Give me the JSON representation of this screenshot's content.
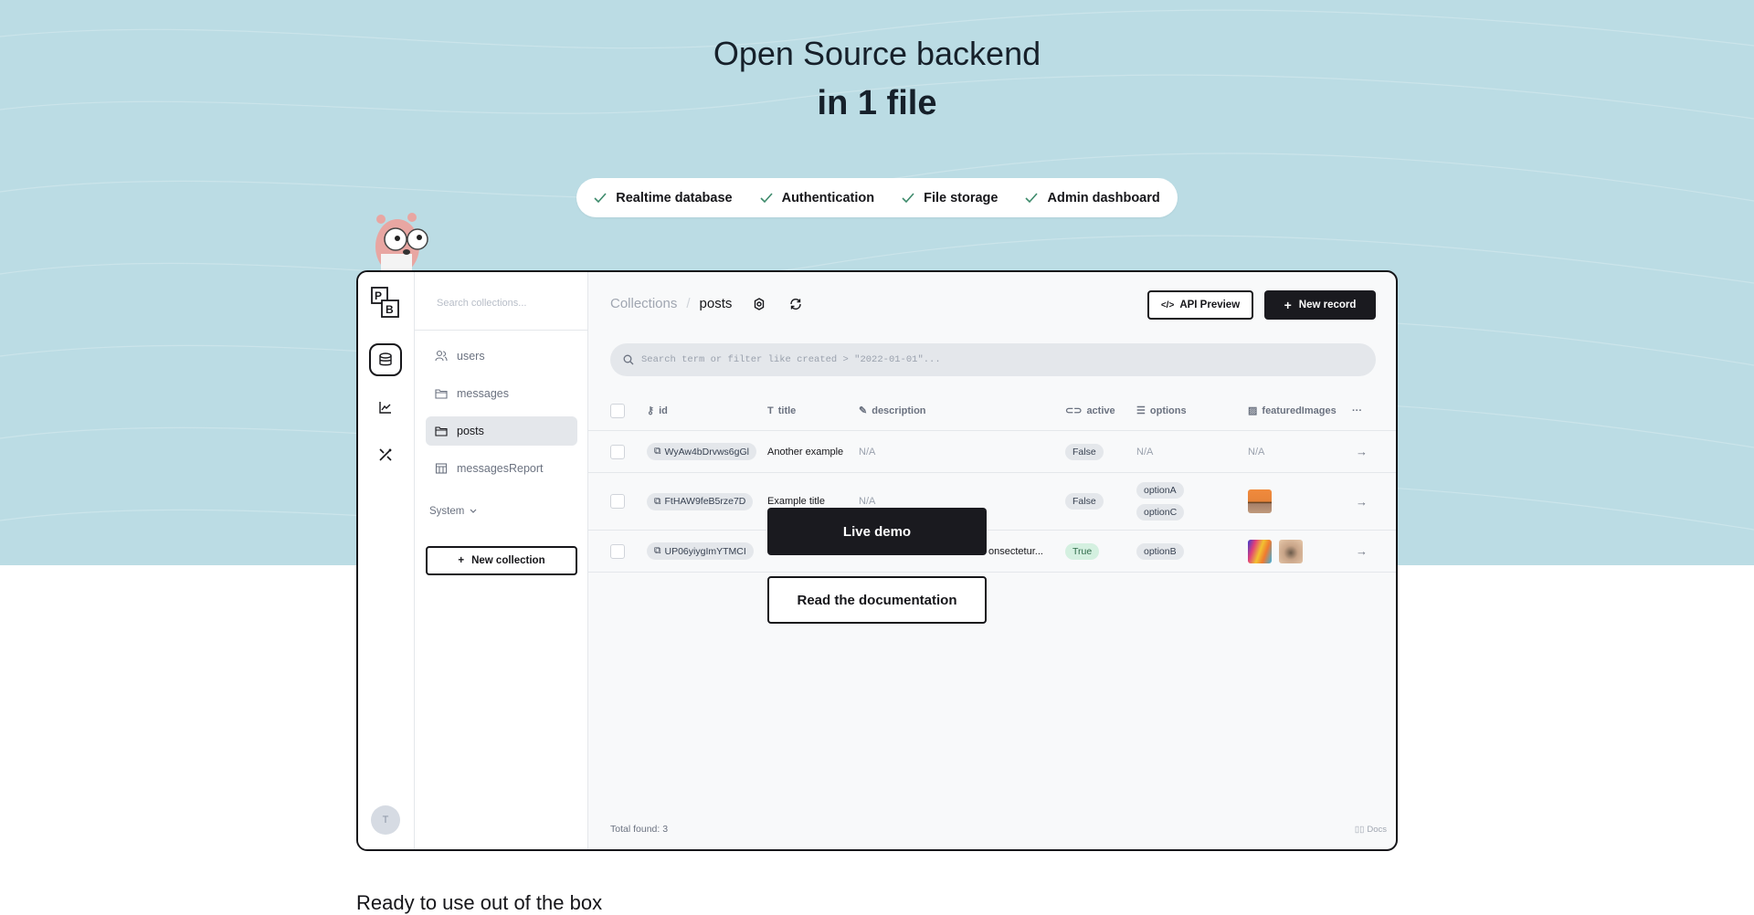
{
  "hero": {
    "title_line1": "Open Source backend",
    "title_line2": "in 1 file",
    "background_color": "#bbdce4",
    "features": [
      {
        "icon": "check-icon",
        "label": "Realtime database"
      },
      {
        "icon": "check-icon",
        "label": "Authentication"
      },
      {
        "icon": "check-icon",
        "label": "File storage"
      },
      {
        "icon": "check-icon",
        "label": "Admin dashboard"
      }
    ]
  },
  "app": {
    "logo_text": "PB",
    "rail": [
      {
        "icon": "database-icon",
        "active": true
      },
      {
        "icon": "chart-icon",
        "active": false
      },
      {
        "icon": "tools-icon",
        "active": false
      }
    ],
    "avatar_initial": "T",
    "sidebar": {
      "search_placeholder": "Search collections...",
      "items": [
        {
          "icon": "users-icon",
          "label": "users",
          "active": false
        },
        {
          "icon": "folder-icon",
          "label": "messages",
          "active": false
        },
        {
          "icon": "folder-icon",
          "label": "posts",
          "active": true
        },
        {
          "icon": "table-icon",
          "label": "messagesReport",
          "active": false
        }
      ],
      "system_label": "System",
      "new_collection_label": "New collection"
    },
    "main": {
      "breadcrumb_root": "Collections",
      "breadcrumb_separator": "/",
      "breadcrumb_current": "posts",
      "api_preview_label": "API Preview",
      "new_record_label": "New record",
      "search_placeholder": "Search term or filter like created > \"2022-01-01\"...",
      "columns": [
        {
          "icon": "key-icon",
          "label": "id"
        },
        {
          "icon": "text-icon",
          "label": "title"
        },
        {
          "icon": "edit-icon",
          "label": "description"
        },
        {
          "icon": "toggle-icon",
          "label": "active"
        },
        {
          "icon": "list-icon",
          "label": "options"
        },
        {
          "icon": "image-icon",
          "label": "featuredImages"
        }
      ],
      "more_label": "···",
      "rows": [
        {
          "id": "WyAw4bDrvws6gGl",
          "title": "Another example",
          "description": "N/A",
          "active": "False",
          "options": [],
          "options_empty": "N/A",
          "images": [],
          "images_empty": "N/A"
        },
        {
          "id": "FtHAW9feB5rze7D",
          "title": "Example title",
          "description": "N/A",
          "active": "False",
          "options": [
            "optionA",
            "optionC"
          ],
          "images": [
            "desert"
          ]
        },
        {
          "id": "UP06yiygImYTMCI",
          "title": "",
          "description": "onsectetur...",
          "active": "True",
          "options": [
            "optionB"
          ],
          "images": [
            "rainbow",
            "cat"
          ]
        }
      ],
      "total_label": "Total found:",
      "total_value": "3",
      "docs_label": "Docs"
    }
  },
  "cta": {
    "live_demo": "Live demo",
    "read_docs": "Read the documentation"
  },
  "below_fold_heading": "Ready to use out of the box"
}
